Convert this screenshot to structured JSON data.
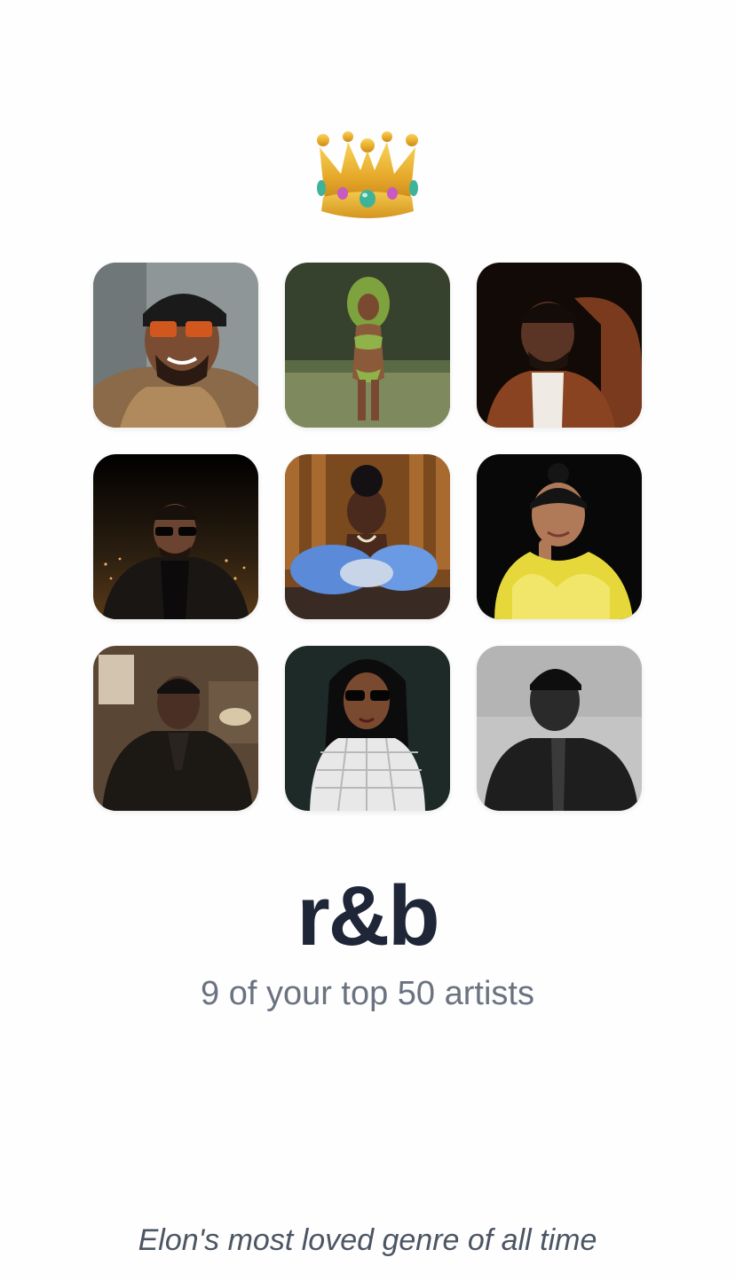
{
  "header": {
    "icon": "crown-icon"
  },
  "artists": [
    {
      "name": "artist-1",
      "bg": "#8c8f8f"
    },
    {
      "name": "artist-2",
      "bg": "#3f4a35"
    },
    {
      "name": "artist-3",
      "bg": "#3a2318"
    },
    {
      "name": "artist-4",
      "bg": "#151210"
    },
    {
      "name": "artist-5",
      "bg": "#8a5a2a"
    },
    {
      "name": "artist-6",
      "bg": "#0e0e0e"
    },
    {
      "name": "artist-7",
      "bg": "#4a3a2a"
    },
    {
      "name": "artist-8",
      "bg": "#1e2a28"
    },
    {
      "name": "artist-9",
      "bg": "#bdbdbd"
    }
  ],
  "genre": {
    "title": "r&b",
    "subtitle": "9 of your top 50 artists"
  },
  "footer": {
    "caption": "Elon's most loved genre of all time"
  }
}
